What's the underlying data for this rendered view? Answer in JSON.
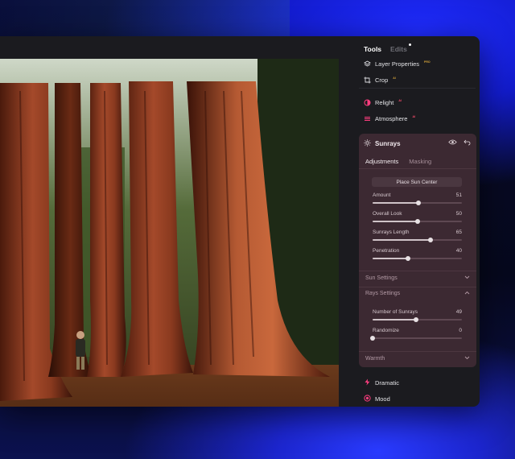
{
  "panel": {
    "tabs": [
      {
        "label": "Tools"
      },
      {
        "label": "Edits"
      }
    ],
    "tools_top": [
      {
        "label": "Layer Properties",
        "badge": "PRO",
        "icon": "layers-icon"
      },
      {
        "label": "Crop",
        "badge": "AI",
        "icon": "crop-icon"
      }
    ],
    "tools_mid": [
      {
        "label": "Relight",
        "badge": "AI",
        "icon": "relight-icon"
      },
      {
        "label": "Atmosphere",
        "badge": "AI",
        "icon": "atmosphere-icon"
      }
    ],
    "sunrays": {
      "title": "Sunrays",
      "subtabs": [
        {
          "label": "Adjustments"
        },
        {
          "label": "Masking"
        }
      ],
      "place_button": "Place Sun Center",
      "sliders": [
        {
          "label": "Amount",
          "value": "51",
          "level": 0.51
        },
        {
          "label": "Overall Look",
          "value": "50",
          "level": 0.5
        },
        {
          "label": "Sunrays Length",
          "value": "65",
          "level": 0.65
        },
        {
          "label": "Penetration",
          "value": "40",
          "level": 0.4
        }
      ],
      "sun_settings": "Sun Settings",
      "rays_settings": "Rays Settings",
      "rays_sliders": [
        {
          "label": "Number of Sunrays",
          "value": "49",
          "level": 0.49
        },
        {
          "label": "Randomize",
          "value": "0",
          "level": 0.0
        }
      ],
      "warmth": "Warmth"
    },
    "tools_bottom": [
      {
        "label": "Dramatic",
        "icon": "lightning-icon"
      },
      {
        "label": "Mood",
        "icon": "mood-icon"
      }
    ],
    "accent": "#ff3d7f"
  }
}
